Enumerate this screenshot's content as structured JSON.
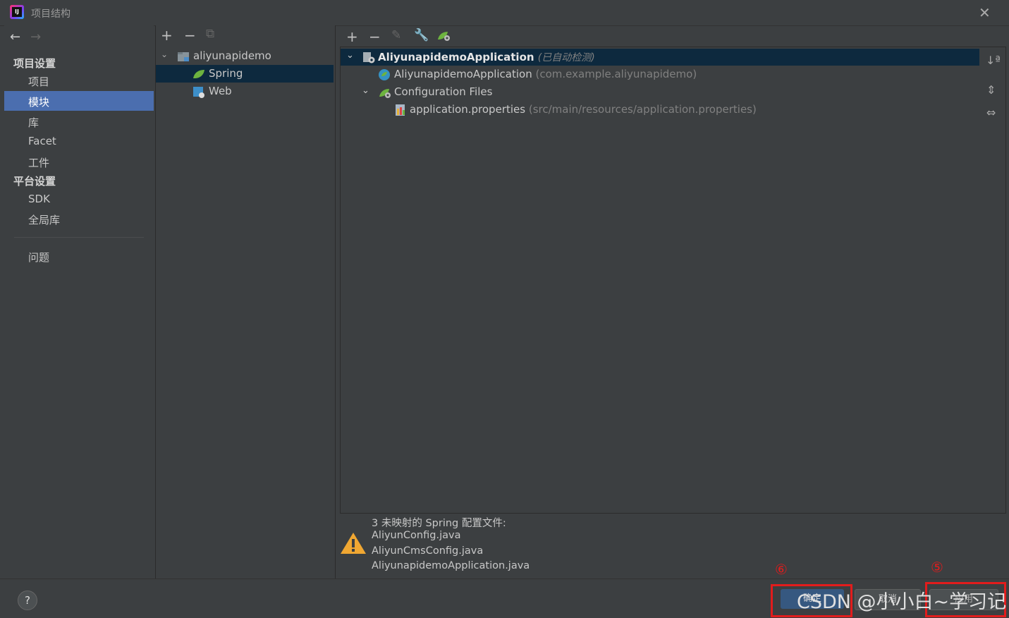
{
  "window": {
    "title": "项目结构",
    "logo_text": "IJ"
  },
  "left_nav": {
    "back": "←",
    "forward": "→",
    "section_project": "项目设置",
    "items_project": [
      "项目",
      "模块",
      "库",
      "Facet",
      "工件"
    ],
    "section_platform": "平台设置",
    "items_platform": [
      "SDK",
      "全局库"
    ],
    "problems": "问题"
  },
  "module_tree": {
    "toolbar": {
      "add": "+",
      "remove": "−",
      "copy": "⧉"
    },
    "root": "aliyunapidemo",
    "children": [
      "Spring",
      "Web"
    ]
  },
  "spring_panel": {
    "toolbar": {
      "add": "+",
      "remove": "−"
    },
    "root_label": "AliyunapidemoApplication",
    "root_note": "(已自动检测)",
    "app_class": "AliyunapidemoApplication",
    "app_package": "(com.example.aliyunapidemo)",
    "config_files": "Configuration Files",
    "properties_file": "application.properties",
    "properties_path": "(src/main/resources/application.properties)"
  },
  "warning": {
    "header": "3 未映射的 Spring 配置文件:",
    "files": [
      "AliyunConfig.java",
      "AliyunCmsConfig.java",
      "AliyunapidemoApplication.java"
    ]
  },
  "buttons": {
    "ok": "确定",
    "cancel": "取消",
    "apply": "应用"
  },
  "annotations": {
    "six": "⑥",
    "five": "⑤"
  },
  "watermark": "CSDN @小小白~学习记"
}
